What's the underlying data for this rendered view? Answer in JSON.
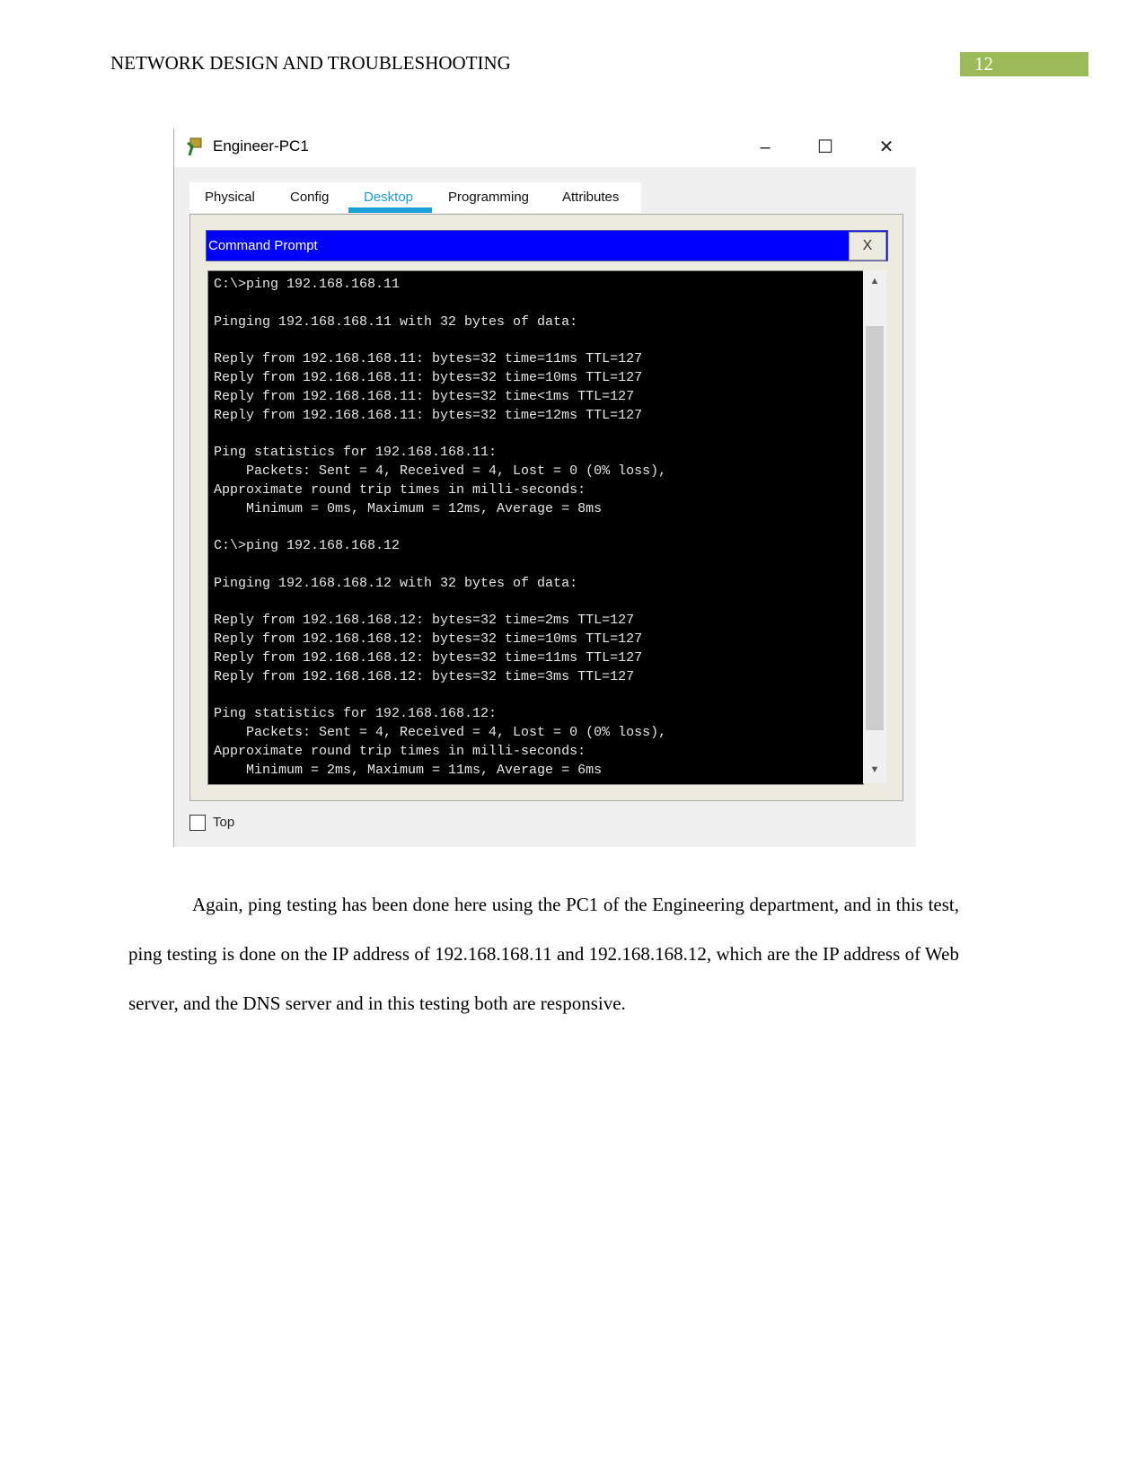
{
  "header": {
    "title": "NETWORK DESIGN AND TROUBLESHOOTING",
    "page_number": "12",
    "page_number_bg": "#9bbb59"
  },
  "window": {
    "title": "Engineer-PC1",
    "controls": {
      "minimize": "–",
      "maximize": "☐",
      "close": "✕"
    },
    "tabs": [
      {
        "label": "Physical"
      },
      {
        "label": "Config"
      },
      {
        "label": "Desktop",
        "active": true
      },
      {
        "label": "Programming"
      },
      {
        "label": "Attributes"
      }
    ],
    "accent": "#1a9fd8",
    "command_prompt": {
      "title": "Command Prompt",
      "close_label": "X",
      "title_bg": "#0000ff",
      "lines": [
        "C:\\>ping 192.168.168.11",
        "",
        "Pinging 192.168.168.11 with 32 bytes of data:",
        "",
        "Reply from 192.168.168.11: bytes=32 time=11ms TTL=127",
        "Reply from 192.168.168.11: bytes=32 time=10ms TTL=127",
        "Reply from 192.168.168.11: bytes=32 time<1ms TTL=127",
        "Reply from 192.168.168.11: bytes=32 time=12ms TTL=127",
        "",
        "Ping statistics for 192.168.168.11:",
        "    Packets: Sent = 4, Received = 4, Lost = 0 (0% loss),",
        "Approximate round trip times in milli-seconds:",
        "    Minimum = 0ms, Maximum = 12ms, Average = 8ms",
        "",
        "C:\\>ping 192.168.168.12",
        "",
        "Pinging 192.168.168.12 with 32 bytes of data:",
        "",
        "Reply from 192.168.168.12: bytes=32 time=2ms TTL=127",
        "Reply from 192.168.168.12: bytes=32 time=10ms TTL=127",
        "Reply from 192.168.168.12: bytes=32 time=11ms TTL=127",
        "Reply from 192.168.168.12: bytes=32 time=3ms TTL=127",
        "",
        "Ping statistics for 192.168.168.12:",
        "    Packets: Sent = 4, Received = 4, Lost = 0 (0% loss),",
        "Approximate round trip times in milli-seconds:",
        "    Minimum = 2ms, Maximum = 11ms, Average = 6ms"
      ]
    },
    "top_checkbox": {
      "label": "Top",
      "checked": false
    }
  },
  "body": {
    "paragraph": "Again, ping testing has been done here using the PC1 of the Engineering department, and in this test, ping testing is done on the IP address of 192.168.168.11 and 192.168.168.12, which are the IP address of Web server, and the DNS server and in this testing both are responsive."
  }
}
